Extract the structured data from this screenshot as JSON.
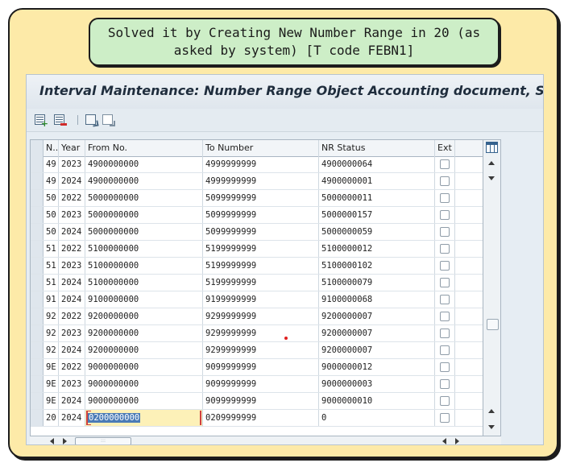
{
  "callout": {
    "line1": "Solved it by Creating New Number Range in 20 (as",
    "line2": "asked by system) [T code FEBN1]"
  },
  "window": {
    "title": "Interval Maintenance: Number Range Object Accounting document, Subo"
  },
  "toolbar": {
    "buttons": [
      "insert-line",
      "delete-line",
      "select-all",
      "deselect-all"
    ]
  },
  "table": {
    "headers": {
      "no": "N..",
      "year": "Year",
      "from": "From No.",
      "to": "To Number",
      "status": "NR Status",
      "ext": "Ext"
    },
    "rows": [
      {
        "no": "49",
        "year": "2023",
        "from": "4900000000",
        "to": "4999999999",
        "status": "4900000064",
        "ext": false
      },
      {
        "no": "49",
        "year": "2024",
        "from": "4900000000",
        "to": "4999999999",
        "status": "4900000001",
        "ext": false
      },
      {
        "no": "50",
        "year": "2022",
        "from": "5000000000",
        "to": "5099999999",
        "status": "5000000011",
        "ext": false
      },
      {
        "no": "50",
        "year": "2023",
        "from": "5000000000",
        "to": "5099999999",
        "status": "5000000157",
        "ext": false
      },
      {
        "no": "50",
        "year": "2024",
        "from": "5000000000",
        "to": "5099999999",
        "status": "5000000059",
        "ext": false
      },
      {
        "no": "51",
        "year": "2022",
        "from": "5100000000",
        "to": "5199999999",
        "status": "5100000012",
        "ext": false
      },
      {
        "no": "51",
        "year": "2023",
        "from": "5100000000",
        "to": "5199999999",
        "status": "5100000102",
        "ext": false
      },
      {
        "no": "51",
        "year": "2024",
        "from": "5100000000",
        "to": "5199999999",
        "status": "5100000079",
        "ext": false
      },
      {
        "no": "91",
        "year": "2024",
        "from": "9100000000",
        "to": "9199999999",
        "status": "9100000068",
        "ext": false
      },
      {
        "no": "92",
        "year": "2022",
        "from": "9200000000",
        "to": "9299999999",
        "status": "9200000007",
        "ext": false
      },
      {
        "no": "92",
        "year": "2023",
        "from": "9200000000",
        "to": "9299999999",
        "status": "9200000007",
        "ext": false
      },
      {
        "no": "92",
        "year": "2024",
        "from": "9200000000",
        "to": "9299999999",
        "status": "9200000007",
        "ext": false
      },
      {
        "no": "9E",
        "year": "2022",
        "from": "9000000000",
        "to": "9099999999",
        "status": "9000000012",
        "ext": false
      },
      {
        "no": "9E",
        "year": "2023",
        "from": "9000000000",
        "to": "9099999999",
        "status": "9000000003",
        "ext": false
      },
      {
        "no": "9E",
        "year": "2024",
        "from": "9000000000",
        "to": "9099999999",
        "status": "9000000010",
        "ext": false
      },
      {
        "no": "20",
        "year": "2024",
        "from": "0200000000",
        "to": "0209999999",
        "status": "0",
        "ext": false,
        "editing": true
      }
    ]
  },
  "colors": {
    "frame_bg": "#fdeaa8",
    "callout_bg": "#cdeec7",
    "sap_bg": "#e6edf3",
    "edit_bg": "#fdf1b8",
    "edit_border": "#d04040",
    "selection": "#4b7bb6"
  },
  "icons": [
    "insert-row-icon",
    "delete-row-icon",
    "select-all-icon",
    "deselect-all-icon",
    "table-settings-icon",
    "scroll-up-icon",
    "scroll-down-icon",
    "scroll-left-icon",
    "scroll-right-icon"
  ]
}
